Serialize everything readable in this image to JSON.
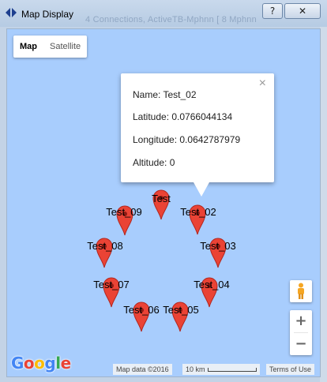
{
  "window": {
    "title": "Map Display",
    "background_text": "4 Connections, ActiveTB-Mphnn [ 8 Mphnn",
    "help_label": "?",
    "close_label": "✕"
  },
  "map_type": {
    "map": "Map",
    "satellite": "Satellite",
    "selected": "Map"
  },
  "info_window": {
    "name": "Name: Test_02",
    "latitude": "Latitude: 0.0766044134",
    "longitude": "Longitude: 0.0642787979",
    "altitude": "Altitude: 0",
    "close_label": "×"
  },
  "markers": [
    {
      "label": "Test"
    },
    {
      "label": "Test_09"
    },
    {
      "label": "Test_02"
    },
    {
      "label": "Test_08"
    },
    {
      "label": "Test_03"
    },
    {
      "label": "Test_07"
    },
    {
      "label": "Test_04"
    },
    {
      "label": "Test_06"
    },
    {
      "label": "Test_05"
    }
  ],
  "controls": {
    "zoom_in": "+",
    "zoom_out": "−"
  },
  "footer": {
    "logo": "Google",
    "map_data": "Map data ©2016",
    "scale": "10 km",
    "terms": "Terms of Use"
  },
  "colors": {
    "marker": "#ea4335",
    "water": "#a8cdfd",
    "pegman": "#f5a623"
  }
}
